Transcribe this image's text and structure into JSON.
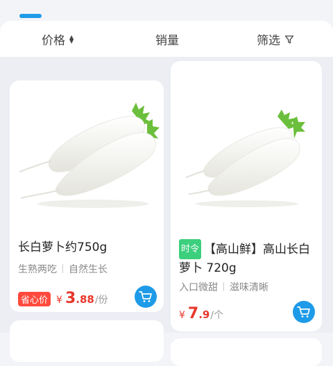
{
  "sortbar": {
    "price_label": "价格",
    "sales_label": "销量",
    "filter_label": "筛选"
  },
  "products": [
    {
      "title": "长白萝卜约750g",
      "tags": [
        "生熟两吃",
        "自然生长"
      ],
      "badge": "省心价",
      "currency": "¥",
      "price_int": "3",
      "price_dec": ".88",
      "unit": "/份"
    },
    {
      "season_badge": "时令",
      "title": "【高山鲜】高山长白萝卜 720g",
      "tags": [
        "入口微甜",
        "滋味清晰"
      ],
      "currency": "¥",
      "price_int": "7",
      "price_dec": ".9",
      "unit": "/个"
    }
  ],
  "colors": {
    "accent_blue": "#1e9be8",
    "price_red": "#e8372b",
    "badge_green": "#3ccf7d"
  },
  "icons": [
    "sort-updown-icon",
    "filter-funnel-icon",
    "cart-icon"
  ]
}
